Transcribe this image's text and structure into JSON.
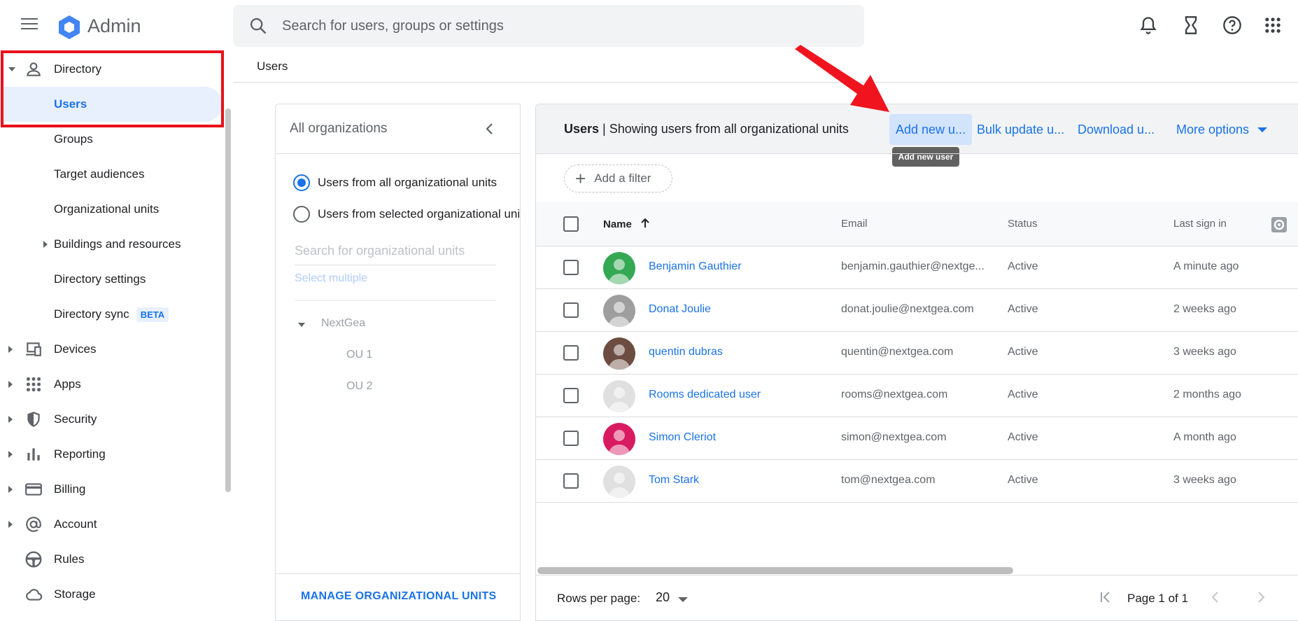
{
  "app": {
    "title": "Admin"
  },
  "search": {
    "placeholder": "Search for users, groups or settings"
  },
  "topbar_icons": [
    "bell-icon",
    "hourglass-icon",
    "help-icon",
    "apps-grid-icon"
  ],
  "sidebar": {
    "directory": "Directory",
    "sub_items": [
      {
        "label": "Users",
        "active": true
      },
      {
        "label": "Groups"
      },
      {
        "label": "Target audiences"
      },
      {
        "label": "Organizational units"
      },
      {
        "label": "Buildings and resources"
      },
      {
        "label": "Directory settings"
      },
      {
        "label": "Directory sync",
        "badge": "BETA"
      }
    ],
    "items": [
      {
        "label": "Devices",
        "icon": "devices-icon"
      },
      {
        "label": "Apps",
        "icon": "apps-icon"
      },
      {
        "label": "Security",
        "icon": "shield-icon"
      },
      {
        "label": "Reporting",
        "icon": "bar-chart-icon"
      },
      {
        "label": "Billing",
        "icon": "credit-card-icon"
      },
      {
        "label": "Account",
        "icon": "at-sign-icon"
      },
      {
        "label": "Rules",
        "icon": "steering-wheel-icon"
      },
      {
        "label": "Storage",
        "icon": "cloud-icon"
      }
    ]
  },
  "breadcrumb": {
    "title": "Users"
  },
  "org_panel": {
    "heading": "All organizations",
    "radio_all": "Users from all organizational units",
    "radio_selected": "Users from selected organizational units",
    "search_placeholder": "Search for organizational units",
    "select_multiple": "Select multiple",
    "tree": {
      "root": "NextGea",
      "children": [
        "OU 1",
        "OU 2"
      ]
    },
    "manage_link": "MANAGE ORGANIZATIONAL UNITS"
  },
  "users_panel": {
    "title_bold": "Users",
    "title_rest": " | Showing users from all organizational units",
    "actions": {
      "add": "Add new u...",
      "bulk": "Bulk update u...",
      "download": "Download u...",
      "more": "More options"
    },
    "tooltip": "Add new user",
    "filter_label": "Add a filter",
    "columns": {
      "name": "Name",
      "email": "Email",
      "status": "Status",
      "last_sign_in": "Last sign in"
    },
    "rows": [
      {
        "name": "Benjamin Gauthier",
        "email": "benjamin.gauthier@nextge...",
        "status": "Active",
        "last_sign_in": "A minute ago",
        "avatar_color": "#34a853"
      },
      {
        "name": "Donat Joulie",
        "email": "donat.joulie@nextgea.com",
        "status": "Active",
        "last_sign_in": "2 weeks ago",
        "avatar_color": "#9e9e9e"
      },
      {
        "name": "quentin dubras",
        "email": "quentin@nextgea.com",
        "status": "Active",
        "last_sign_in": "3 weeks ago",
        "avatar_color": "#6d4c41"
      },
      {
        "name": "Rooms dedicated user",
        "email": "rooms@nextgea.com",
        "status": "Active",
        "last_sign_in": "2 months ago",
        "avatar_color": "#e0e0e0"
      },
      {
        "name": "Simon Cleriot",
        "email": "simon@nextgea.com",
        "status": "Active",
        "last_sign_in": "A month ago",
        "avatar_color": "#d81b60"
      },
      {
        "name": "Tom Stark",
        "email": "tom@nextgea.com",
        "status": "Active",
        "last_sign_in": "3 weeks ago",
        "avatar_color": "#e0e0e0"
      }
    ],
    "footer": {
      "rows_per_page_label": "Rows per page:",
      "rows_per_page_value": "20",
      "page_info": "Page 1 of 1"
    }
  },
  "colors": {
    "accent": "#1a73e8",
    "highlight": "#e8121b",
    "active_bg": "#e8f0fe"
  }
}
